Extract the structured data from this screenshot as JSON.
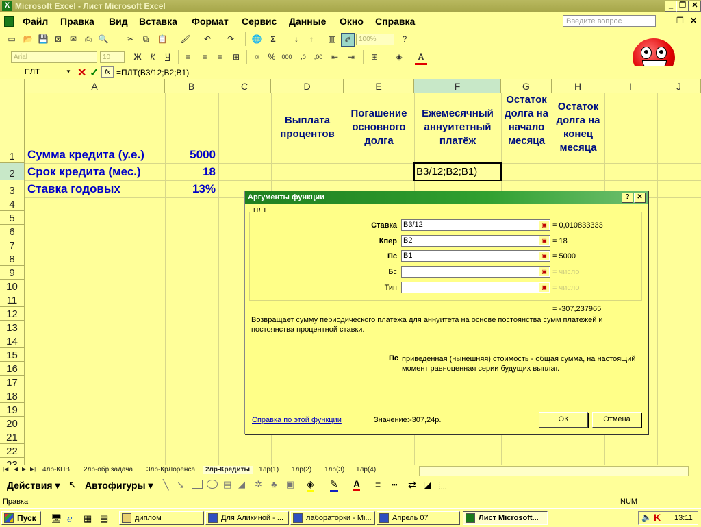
{
  "window": {
    "title": "Microsoft Excel - Лист Microsoft Excel"
  },
  "menu": {
    "items": [
      "Файл",
      "Правка",
      "Вид",
      "Вставка",
      "Формат",
      "Сервис",
      "Данные",
      "Окно",
      "Справка"
    ],
    "help_placeholder": "Введите вопрос"
  },
  "toolbar": {
    "zoom": "100%",
    "font_name": "Arial",
    "font_size": "10"
  },
  "formula_bar": {
    "name_box": "ПЛТ",
    "formula": "=ПЛТ(B3/12;B2;B1)"
  },
  "grid": {
    "columns": [
      "A",
      "B",
      "C",
      "D",
      "E",
      "F",
      "G",
      "H",
      "I",
      "J"
    ],
    "rows": [
      "1",
      "2",
      "3",
      "4",
      "5",
      "6",
      "7",
      "8",
      "9",
      "10",
      "11",
      "12",
      "13",
      "14",
      "15",
      "16",
      "17",
      "18",
      "19",
      "20",
      "21",
      "22",
      "23"
    ],
    "headers": {
      "D": "Выплата процентов",
      "E": "Погашение основного долга",
      "F": "Ежемесячный аннуитетный платёж",
      "G": "Остаток долга на начало месяца",
      "H": "Остаток долга на конец месяца"
    },
    "a1": "Сумма кредита (у.е.)",
    "b1": "5000",
    "a2": "Срок кредита (мес.)",
    "b2": "18",
    "a3": "Ставка годовых",
    "b3": "13%",
    "f2_editing": "B3/12;B2;B1)"
  },
  "dialog": {
    "title": "Аргументы функции",
    "function_name": "ПЛТ",
    "args": [
      {
        "label": "Ставка",
        "value": "B3/12",
        "result": "= 0,010833333"
      },
      {
        "label": "Кпер",
        "value": "B2",
        "result": "= 18"
      },
      {
        "label": "Пс",
        "value": "B1",
        "result": "= 5000"
      },
      {
        "label": "Бс",
        "value": "",
        "result": "= число"
      },
      {
        "label": "Тип",
        "value": "",
        "result": "= число"
      }
    ],
    "total": "= -307,237965",
    "description": "Возвращает сумму периодического платежа для аннуитета на основе постоянства сумм платежей и постоянства процентной ставки.",
    "arg_help_name": "Пс",
    "arg_help_text": "приведенная (нынешняя) стоимость - общая сумма, на настоящий момент равноценная серии будущих выплат.",
    "help_link": "Справка по этой функции",
    "value_label": "Значение:",
    "value": "-307,24р.",
    "ok": "ОК",
    "cancel": "Отмена"
  },
  "sheets": [
    "4лр-КПВ",
    "2лр-обр.задача",
    "3лр-КрЛоренса",
    "2лр-Кредиты",
    "1лр(1)",
    "1лр(2)",
    "1лр(3)",
    "1лр(4)"
  ],
  "drawing": {
    "actions": "Действия",
    "autoshapes": "Автофигуры"
  },
  "status": {
    "left": "Правка",
    "num": "NUM"
  },
  "taskbar": {
    "start": "Пуск",
    "items": [
      "диплом",
      "Для Аликиной - ...",
      "лабораторки - Mi...",
      "Апрель 07",
      "Лист Microsoft..."
    ],
    "clock": "13:11"
  }
}
